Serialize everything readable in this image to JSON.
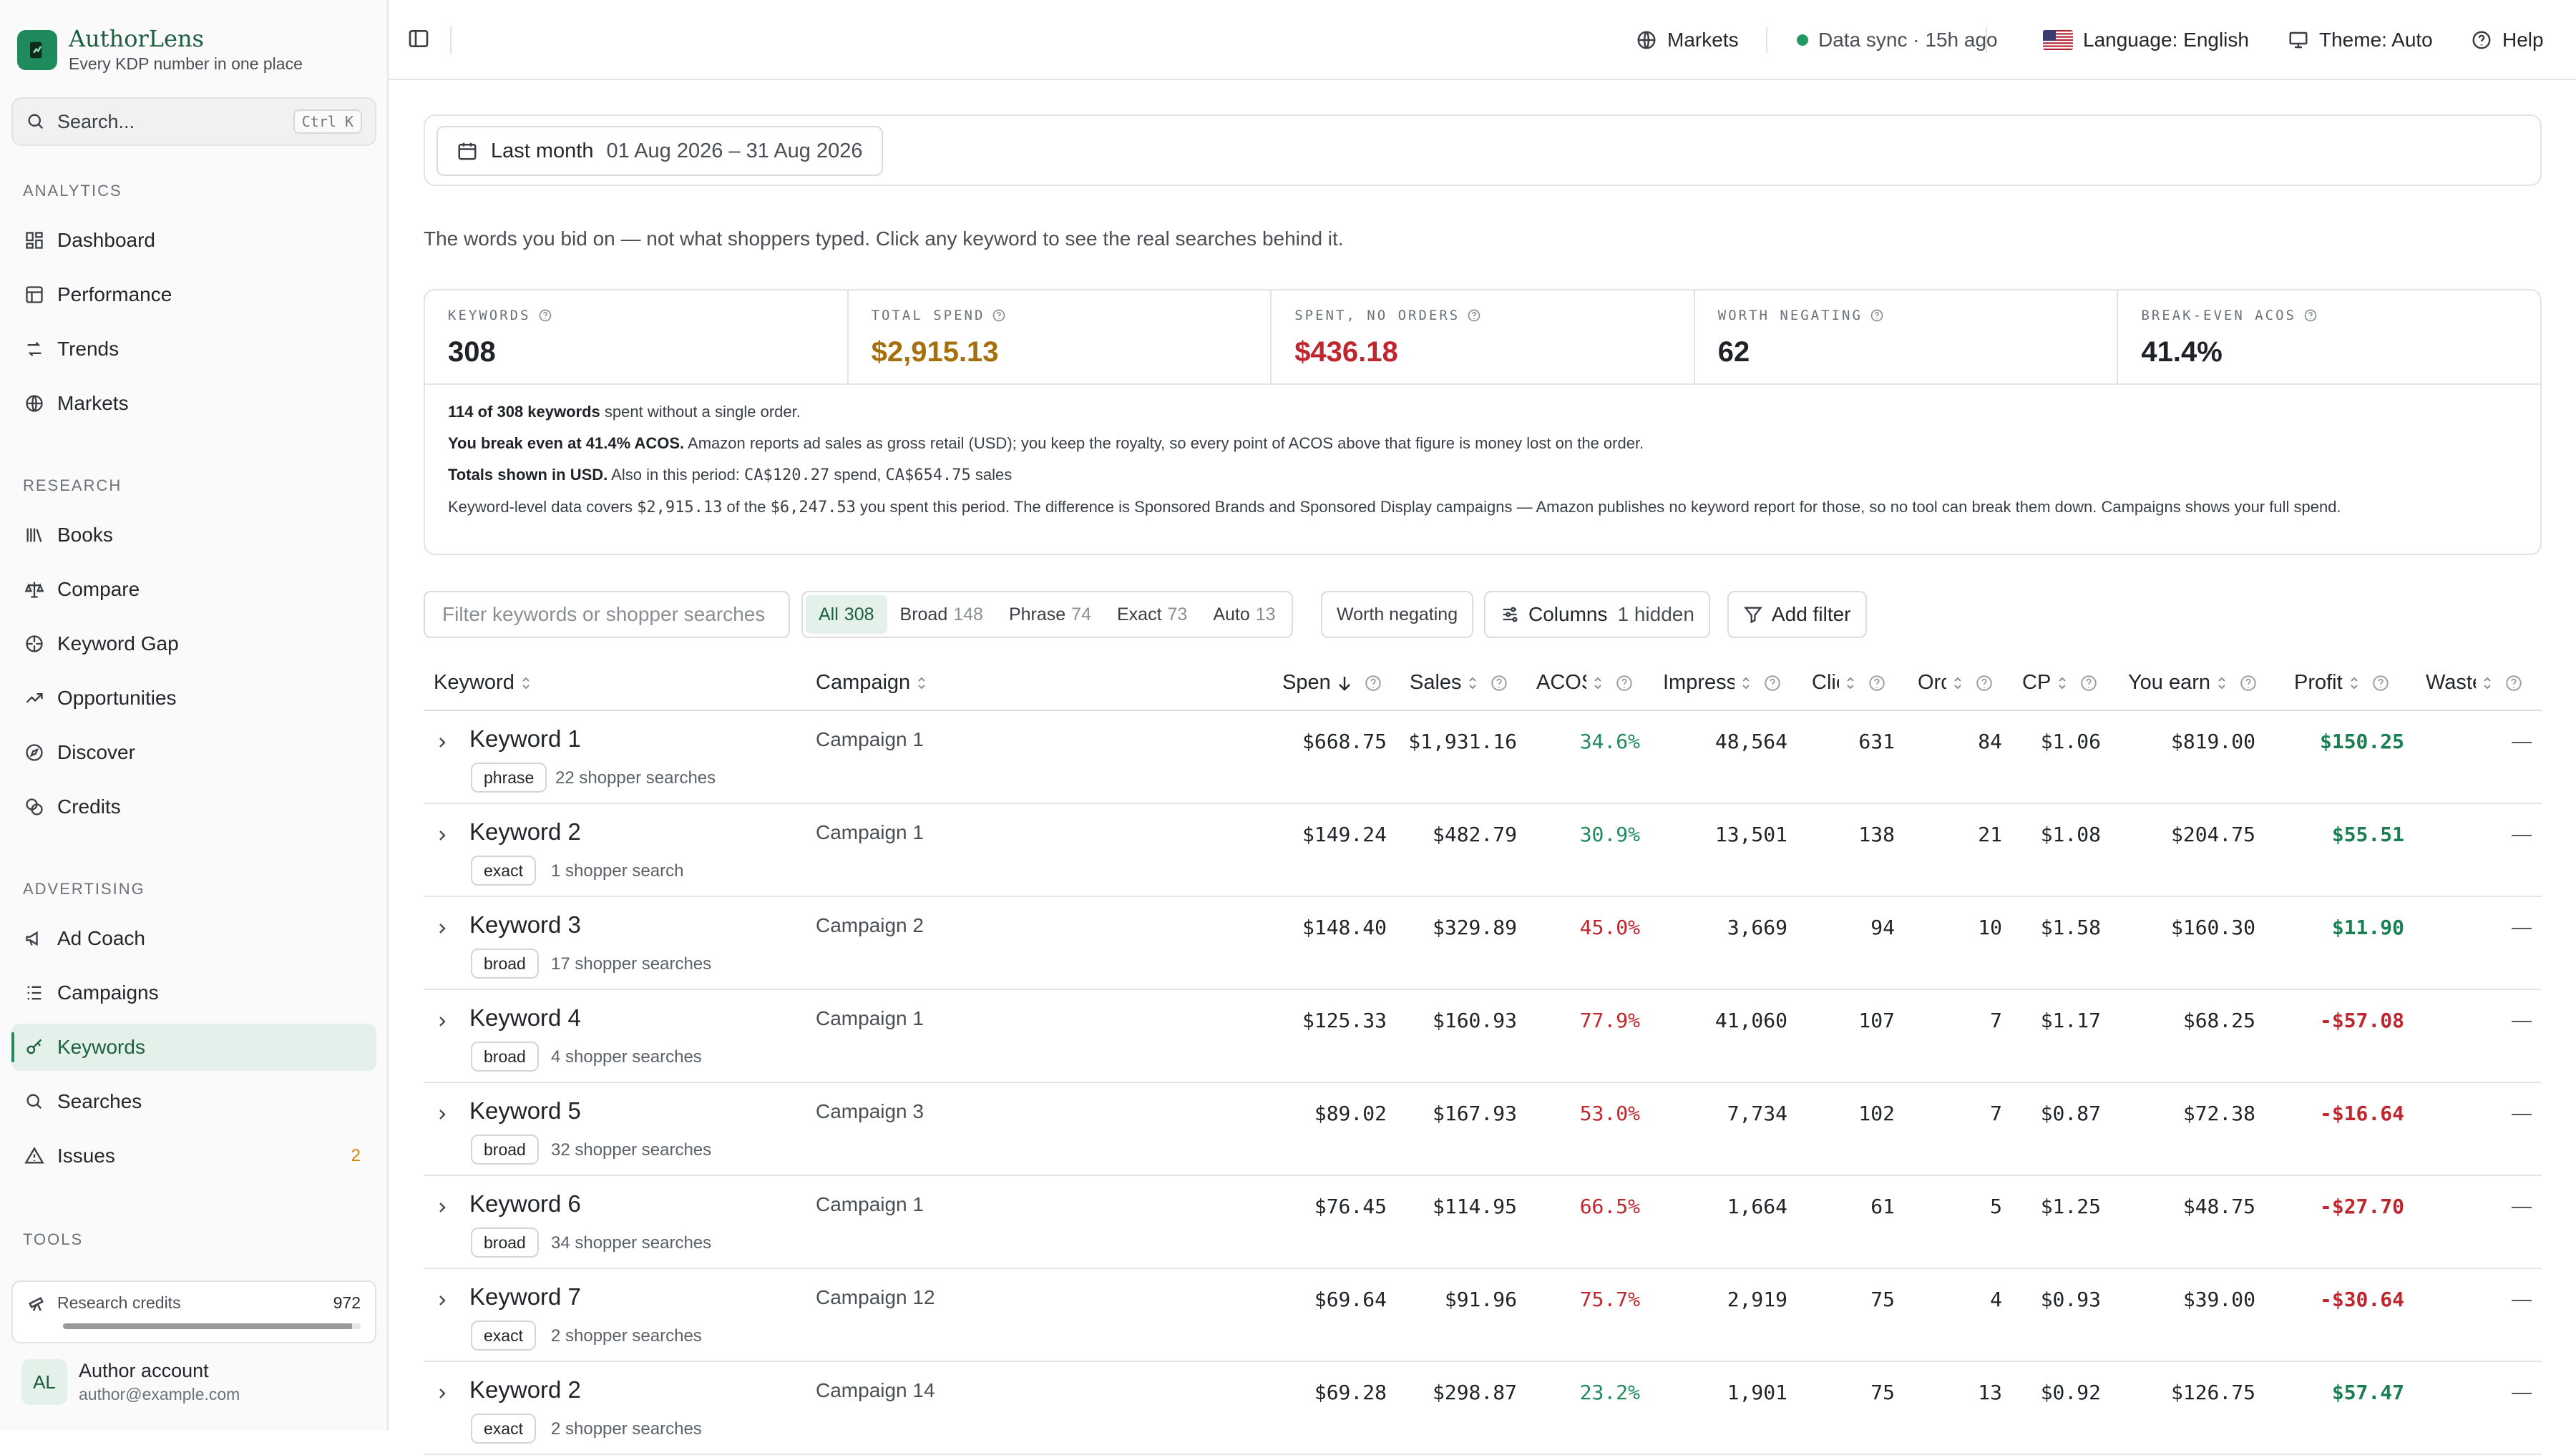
{
  "brand": {
    "name": "AuthorLens",
    "tagline": "Every KDP number in one place"
  },
  "search": {
    "label": "Search...",
    "shortcut": "Ctrl K"
  },
  "sidebar": {
    "sections": [
      {
        "title": "ANALYTICS",
        "items": [
          {
            "label": "Dashboard",
            "icon": "dashboard-icon"
          },
          {
            "label": "Performance",
            "icon": "table-icon"
          },
          {
            "label": "Trends",
            "icon": "trends-icon"
          },
          {
            "label": "Markets",
            "icon": "globe-icon"
          }
        ]
      },
      {
        "title": "RESEARCH",
        "items": [
          {
            "label": "Books",
            "icon": "books-icon"
          },
          {
            "label": "Compare",
            "icon": "scale-icon"
          },
          {
            "label": "Keyword Gap",
            "icon": "gap-icon"
          },
          {
            "label": "Opportunities",
            "icon": "trending-up-icon"
          },
          {
            "label": "Discover",
            "icon": "compass-icon"
          },
          {
            "label": "Credits",
            "icon": "coins-icon"
          }
        ]
      },
      {
        "title": "ADVERTISING",
        "items": [
          {
            "label": "Ad Coach",
            "icon": "megaphone-icon"
          },
          {
            "label": "Campaigns",
            "icon": "list-icon"
          },
          {
            "label": "Keywords",
            "icon": "key-icon",
            "active": true
          },
          {
            "label": "Searches",
            "icon": "search-icon"
          },
          {
            "label": "Issues",
            "icon": "warning-icon",
            "badge": "2"
          }
        ]
      },
      {
        "title": "TOOLS",
        "items": []
      }
    ],
    "credits": {
      "label": "Research credits",
      "value": "972",
      "fill": 0.97
    },
    "account": {
      "initials": "AL",
      "name": "Author account",
      "email": "author@example.com"
    }
  },
  "topbar": {
    "markets": "Markets",
    "sync": "Data sync · 15h ago",
    "language": "Language: English",
    "theme": "Theme: Auto",
    "help": "Help"
  },
  "date": {
    "label": "Last month",
    "range": "01 Aug 2026 – 31 Aug 2026"
  },
  "intro": "The words you bid on — not what shoppers typed. Click any keyword to see the real searches behind it.",
  "stats": [
    {
      "label": "KEYWORDS",
      "value": "308",
      "tone": "normal"
    },
    {
      "label": "TOTAL SPEND",
      "value": "$2,915.13",
      "tone": "warn"
    },
    {
      "label": "SPENT, NO ORDERS",
      "value": "$436.18",
      "tone": "bad"
    },
    {
      "label": "WORTH NEGATING",
      "value": "62",
      "tone": "normal"
    },
    {
      "label": "BREAK-EVEN ACOS",
      "value": "41.4%",
      "tone": "normal"
    }
  ],
  "notes": {
    "n1_bold": "114 of 308 keywords",
    "n1_rest": " spent without a single order.",
    "n2_bold": "You break even at 41.4% ACOS.",
    "n2_rest": " Amazon reports ad sales as gross retail (USD); you keep the royalty, so every point of ACOS above that figure is money lost on the order.",
    "n3_bold": "Totals shown in USD.",
    "n3_a": " Also in this period: ",
    "n3_spend": "CA$120.27",
    "n3_b": " spend, ",
    "n3_sales": "CA$654.75",
    "n3_c": " sales",
    "n4_a": "Keyword-level data covers ",
    "n4_cover": "$2,915.13",
    "n4_b": " of the ",
    "n4_total": "$6,247.53",
    "n4_c": " you spent this period. The difference is Sponsored Brands and Sponsored Display campaigns — Amazon publishes no keyword report for those, so no tool can break them down. Campaigns shows your full spend."
  },
  "filters": {
    "placeholder": "Filter keywords or shopper searches",
    "segments": [
      {
        "label": "All",
        "count": "308",
        "active": true
      },
      {
        "label": "Broad",
        "count": "148"
      },
      {
        "label": "Phrase",
        "count": "74"
      },
      {
        "label": "Exact",
        "count": "73"
      },
      {
        "label": "Auto",
        "count": "13"
      }
    ],
    "worth_negating": "Worth negating",
    "columns": "Columns",
    "columns_hidden": "1 hidden",
    "add_filter": "Add filter"
  },
  "table": {
    "headers": {
      "keyword": "Keyword",
      "campaign": "Campaign",
      "spend": "Spend",
      "sales": "Sales",
      "acos": "ACOS",
      "impressions": "Impressions",
      "clicks": "Clicks",
      "orders": "Orders",
      "cpc": "CPC",
      "you_earn": "You earn",
      "profit": "Profit",
      "wasted": "Wasted"
    },
    "rows": [
      {
        "keyword": "Keyword 1",
        "match": "phrase",
        "searches": "22 shopper searches",
        "campaign": "Campaign 1",
        "spend": "$668.75",
        "sales": "$1,931.16",
        "acos": "34.6%",
        "acos_tone": "good",
        "impressions": "48,564",
        "clicks": "631",
        "orders": "84",
        "cpc": "$1.06",
        "earn": "$819.00",
        "profit": "$150.25",
        "profit_tone": "pgood",
        "wasted": "—"
      },
      {
        "keyword": "Keyword 2",
        "match": "exact",
        "searches": "1 shopper search",
        "campaign": "Campaign 1",
        "spend": "$149.24",
        "sales": "$482.79",
        "acos": "30.9%",
        "acos_tone": "good",
        "impressions": "13,501",
        "clicks": "138",
        "orders": "21",
        "cpc": "$1.08",
        "earn": "$204.75",
        "profit": "$55.51",
        "profit_tone": "pgood",
        "wasted": "—"
      },
      {
        "keyword": "Keyword 3",
        "match": "broad",
        "searches": "17 shopper searches",
        "campaign": "Campaign 2",
        "spend": "$148.40",
        "sales": "$329.89",
        "acos": "45.0%",
        "acos_tone": "bad",
        "impressions": "3,669",
        "clicks": "94",
        "orders": "10",
        "cpc": "$1.58",
        "earn": "$160.30",
        "profit": "$11.90",
        "profit_tone": "pgood",
        "wasted": "—"
      },
      {
        "keyword": "Keyword 4",
        "match": "broad",
        "searches": "4 shopper searches",
        "campaign": "Campaign 1",
        "spend": "$125.33",
        "sales": "$160.93",
        "acos": "77.9%",
        "acos_tone": "bad",
        "impressions": "41,060",
        "clicks": "107",
        "orders": "7",
        "cpc": "$1.17",
        "earn": "$68.25",
        "profit": "-$57.08",
        "profit_tone": "pbad",
        "wasted": "—"
      },
      {
        "keyword": "Keyword 5",
        "match": "broad",
        "searches": "32 shopper searches",
        "campaign": "Campaign 3",
        "spend": "$89.02",
        "sales": "$167.93",
        "acos": "53.0%",
        "acos_tone": "bad",
        "impressions": "7,734",
        "clicks": "102",
        "orders": "7",
        "cpc": "$0.87",
        "earn": "$72.38",
        "profit": "-$16.64",
        "profit_tone": "pbad",
        "wasted": "—"
      },
      {
        "keyword": "Keyword 6",
        "match": "broad",
        "searches": "34 shopper searches",
        "campaign": "Campaign 1",
        "spend": "$76.45",
        "sales": "$114.95",
        "acos": "66.5%",
        "acos_tone": "bad",
        "impressions": "1,664",
        "clicks": "61",
        "orders": "5",
        "cpc": "$1.25",
        "earn": "$48.75",
        "profit": "-$27.70",
        "profit_tone": "pbad",
        "wasted": "—"
      },
      {
        "keyword": "Keyword 7",
        "match": "exact",
        "searches": "2 shopper searches",
        "campaign": "Campaign 12",
        "spend": "$69.64",
        "sales": "$91.96",
        "acos": "75.7%",
        "acos_tone": "bad",
        "impressions": "2,919",
        "clicks": "75",
        "orders": "4",
        "cpc": "$0.93",
        "earn": "$39.00",
        "profit": "-$30.64",
        "profit_tone": "pbad",
        "wasted": "—"
      },
      {
        "keyword": "Keyword 2",
        "match": "exact",
        "searches": "2 shopper searches",
        "campaign": "Campaign 14",
        "spend": "$69.28",
        "sales": "$298.87",
        "acos": "23.2%",
        "acos_tone": "good",
        "impressions": "1,901",
        "clicks": "75",
        "orders": "13",
        "cpc": "$0.92",
        "earn": "$126.75",
        "profit": "$57.47",
        "profit_tone": "pgood",
        "wasted": "—"
      }
    ]
  },
  "colors": {
    "accent": "#1f8a5c",
    "accent_bg": "#e3f1ea",
    "good": "#1f8a5c",
    "bad": "#c0262d",
    "warn": "#a5700c"
  }
}
